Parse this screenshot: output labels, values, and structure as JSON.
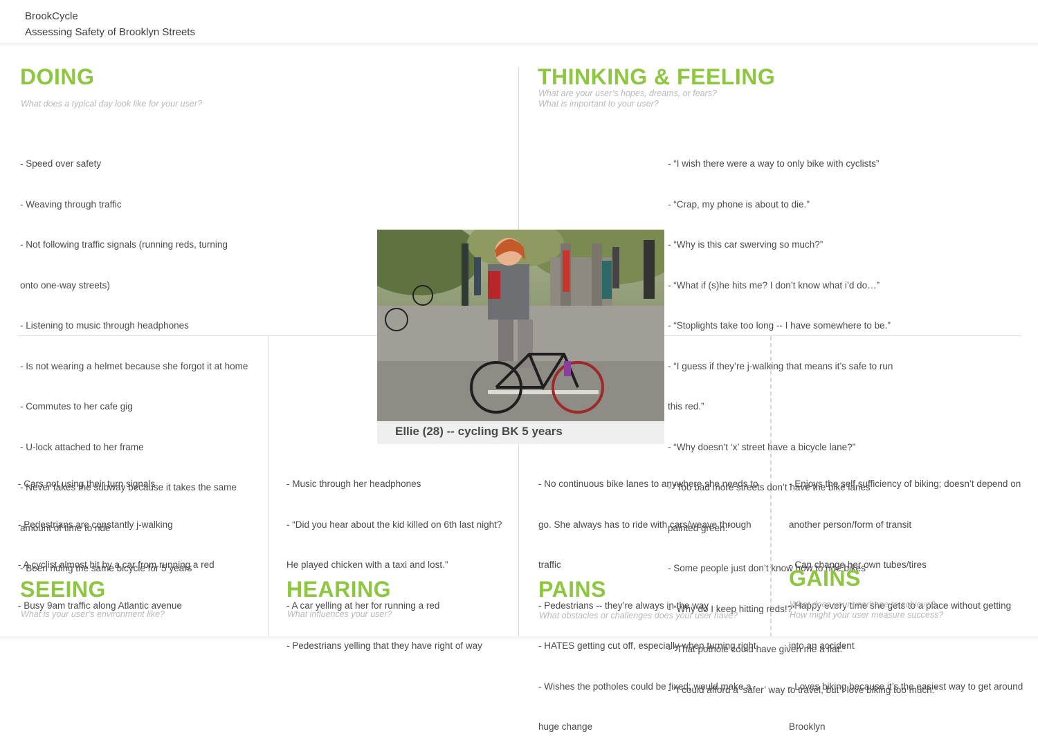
{
  "header": {
    "title": "BrookCycle",
    "subtitle": "Assessing Safety of Brooklyn Streets"
  },
  "colors": {
    "accent": "#8dc63f",
    "text": "#4a4a4a",
    "prompt": "#b8b8b8",
    "divider": "#d9d9d9"
  },
  "persona": {
    "caption": "Ellie (28) -- cycling BK 5 years",
    "photo_icon": "cyclist-photo"
  },
  "doing": {
    "heading": "DOING",
    "prompt_lines": [
      "What does a typical day look like for your user?"
    ],
    "items": [
      "- Speed over safety",
      "- Weaving through traffic",
      "- Not following traffic signals (running reds, turning",
      "  onto one-way streets)",
      "- Listening to music through headphones",
      "- Is not wearing a helmet because she forgot it at home",
      "- Commutes to her cafe gig",
      "- U-lock attached to her frame",
      "- Never takes the subway because it takes the same",
      "  amount of time to ride",
      "- Been riding the same bicycle for 5 years"
    ]
  },
  "thinking": {
    "heading": "THINKING & FEELING",
    "prompt_lines": [
      "What are your user’s hopes, dreams, or fears?",
      "What is important to your user?"
    ],
    "items": [
      "- “I wish there were a way to only bike with cyclists”",
      "- “Crap, my phone is about to die.”",
      "- “Why is this car swerving so much?”",
      "- “What if (s)he hits me? I don’t know what i’d do…”",
      "- “Stoplights take too long -- I have somewhere to be.”",
      "- “I guess if they’re j-walking that means it’s safe to run",
      "  this red.”",
      "- “Why doesn’t ‘x’ street have a bicycle lane?”",
      "-  “Too bad more streets don’t have the bike lanes",
      "  painted green.”",
      "- Some people just don’t know how to ride bikes",
      "- “Why do I keep hitting reds!?”",
      "- “That pothole could have given me a flat.”",
      "- “I could afford a ‘safer’ way to travel, but I love biking too much.”"
    ]
  },
  "seeing": {
    "heading": "SEEING",
    "prompt_lines": [
      "What is your user’s environment like?"
    ],
    "items": [
      "- Cars not using their turn signals",
      "- Pedestrians are constantly j-walking",
      "- A cyclist almost hit by a car from running a red",
      "- Busy 9am traffic along Atlantic avenue"
    ]
  },
  "hearing": {
    "heading": "HEARING",
    "prompt_lines": [
      "What influences your user?"
    ],
    "items": [
      "- Music through her headphones",
      "- “Did you hear about the kid killed on 6th last night?",
      "  He played chicken with a taxi and lost.”",
      "- A car yelling at her for running a red",
      "- Pedestrians yelling that they have right of way"
    ]
  },
  "pains": {
    "heading": "PAINS",
    "prompt_lines": [
      "What obstacles or challenges does your user have?"
    ],
    "items": [
      "- No continuous bike lanes to anywhere she needs to",
      "  go. She always has to ride with cars/weave through",
      "  traffic",
      "- Pedestrians -- they’re always in the way",
      "- HATES getting cut off, especially when turning right",
      "- Wishes the potholes could be fixed; would make a",
      "  huge change"
    ]
  },
  "gains": {
    "heading": "GAINS",
    "prompt_lines": [
      "What does your userhope to achieve?",
      "How might your user measure success?"
    ],
    "items": [
      "- Enjoys the self sufficiency of biking; doesn’t depend on",
      "  another person/form of transit",
      "- Can change her own tubes/tires",
      "- Happy every time she gets to a place without getting",
      "into an accident",
      "- Loves biking because it’s the easiest way to get around",
      "Brooklyn"
    ]
  }
}
